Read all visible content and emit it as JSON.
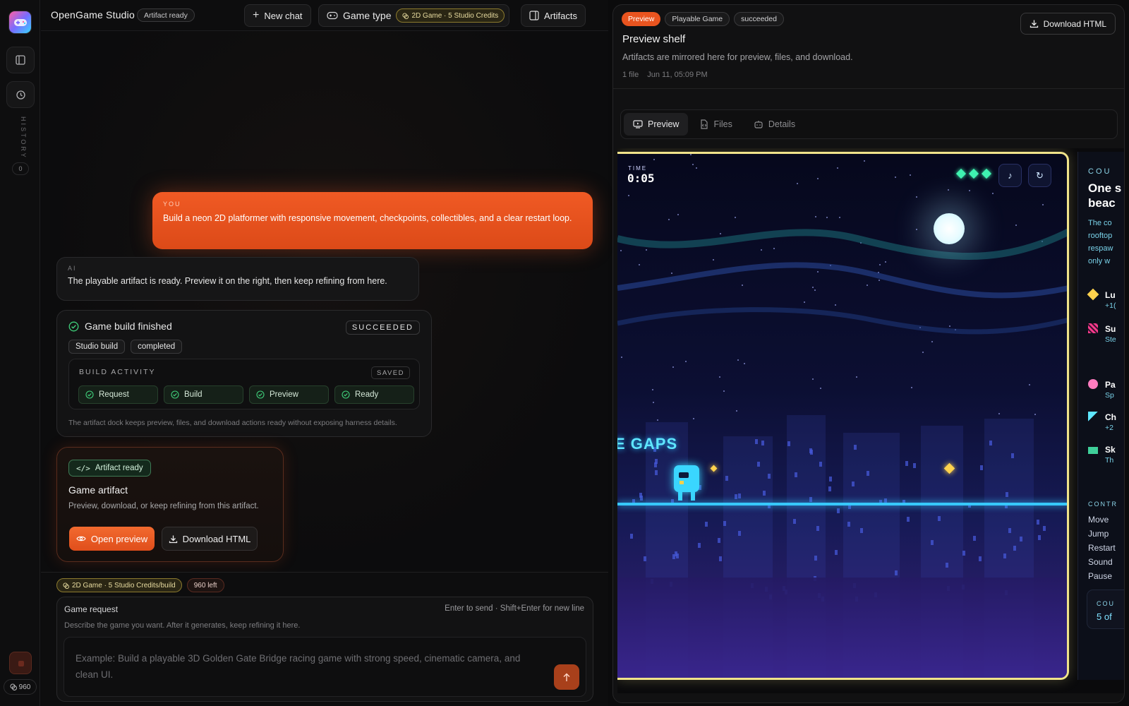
{
  "rail": {
    "history_label": "HISTORY",
    "history_count": "0",
    "credits": "960"
  },
  "topbar": {
    "brand": "OpenGame Studio",
    "status": "Artifact ready",
    "new_chat": "New chat",
    "game_type": "Game type",
    "game_badge": "2D Game · 5 Studio Credits",
    "artifacts": "Artifacts"
  },
  "chat": {
    "user_label": "YOU",
    "user_text": "Build a neon 2D platformer with responsive movement, checkpoints, collectibles, and a clear restart loop.",
    "ai_label": "AI",
    "ai_text": "The playable artifact is ready. Preview it on the right, then keep refining from here.",
    "build": {
      "title": "Game build finished",
      "status": "SUCCEEDED",
      "tags": [
        "Studio build",
        "completed"
      ],
      "activity_label": "BUILD ACTIVITY",
      "saved": "SAVED",
      "steps": [
        "Request",
        "Build",
        "Preview",
        "Ready"
      ],
      "note": "The artifact dock keeps preview, files, and download actions ready without exposing harness details."
    },
    "artifact": {
      "badge": "Artifact ready",
      "title": "Game artifact",
      "desc": "Preview, download, or keep refining from this artifact.",
      "open": "Open preview",
      "download": "Download HTML"
    }
  },
  "composer": {
    "tag1": "2D Game · 5 Studio Credits/build",
    "tag2": "960 left",
    "label": "Game request",
    "hint": "Enter to send · Shift+Enter for new line",
    "sub": "Describe the game you want. After it generates, keep refining it here.",
    "placeholder": "Example: Build a playable 3D Golden Gate Bridge racing game with strong speed, cinematic camera, and clean UI."
  },
  "preview": {
    "tags": [
      "Preview",
      "Playable Game",
      "succeeded"
    ],
    "download": "Download HTML",
    "title": "Preview shelf",
    "desc": "Artifacts are mirrored here for preview, files, and download.",
    "files": "1 file",
    "date": "Jun 11, 05:09 PM",
    "tabs": [
      "Preview",
      "Files",
      "Details"
    ],
    "game": {
      "time_label": "TIME",
      "time": "0:05",
      "banner": "E GAPS",
      "side_head": "COU",
      "side_title": [
        "One s",
        "beac"
      ],
      "side_desc": [
        "The co",
        "rooftop",
        "respaw",
        "only w"
      ],
      "items": [
        {
          "name": "Lu",
          "sub": "+1("
        },
        {
          "name": "Su",
          "sub": "Ste"
        },
        {
          "name": "Pa",
          "sub": "Sp"
        },
        {
          "name": "Ch",
          "sub": "+2"
        },
        {
          "name": "Sk",
          "sub": "Th"
        }
      ],
      "controls_label": "CONTR",
      "controls": [
        "Move",
        "Jump",
        "Restart",
        "Sound",
        "Pause"
      ],
      "count_label": "COU",
      "count": "5 of"
    }
  },
  "colors": {
    "accent": "#e9541f",
    "success": "#3ff2b0",
    "neon": "#37c8ff",
    "frame": "#f0e38a"
  }
}
